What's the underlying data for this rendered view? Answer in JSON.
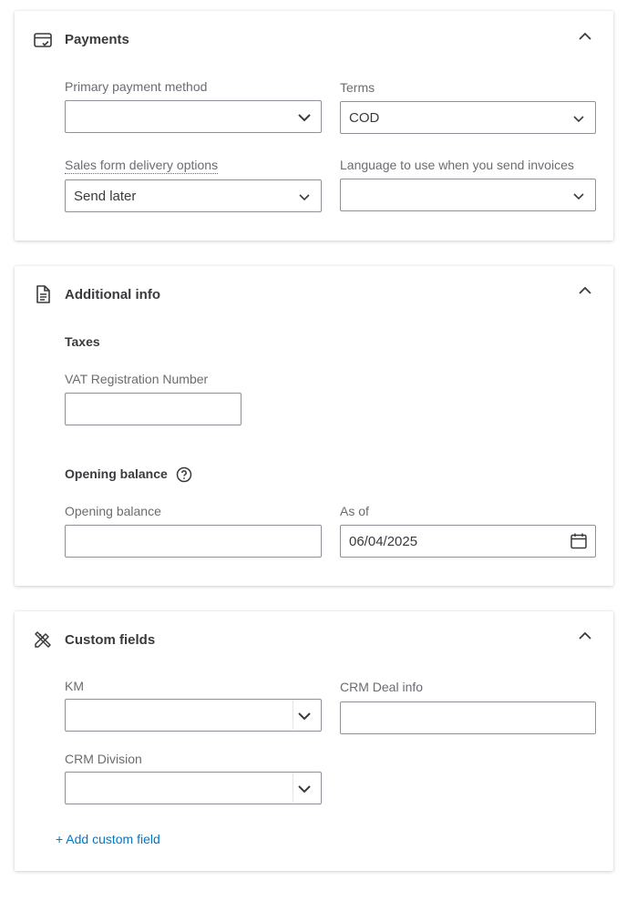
{
  "payments": {
    "title": "Payments",
    "primary_payment_method": {
      "label": "Primary payment method",
      "value": ""
    },
    "terms": {
      "label": "Terms",
      "value": "COD"
    },
    "sales_form_delivery": {
      "label": "Sales form delivery options",
      "value": "Send later"
    },
    "language": {
      "label": "Language to use when you send invoices",
      "value": ""
    }
  },
  "additional_info": {
    "title": "Additional info",
    "taxes_heading": "Taxes",
    "vat": {
      "label": "VAT Registration Number",
      "value": ""
    },
    "opening_balance_heading": "Opening balance",
    "opening_balance": {
      "label": "Opening balance",
      "value": ""
    },
    "as_of": {
      "label": "As of",
      "value": "06/04/2025"
    }
  },
  "custom_fields": {
    "title": "Custom fields",
    "km": {
      "label": "KM",
      "value": ""
    },
    "crm_deal_info": {
      "label": "CRM Deal info",
      "value": ""
    },
    "crm_division": {
      "label": "CRM Division",
      "value": ""
    },
    "add_link": "+ Add custom field"
  },
  "icons": {
    "payments": "payment-card-icon",
    "additional_info": "document-icon",
    "custom_fields": "pencil-ruler-icon",
    "collapse": "chevron-up-icon",
    "dropdown": "chevron-down-icon",
    "help": "question-circle-icon",
    "calendar": "calendar-icon"
  },
  "colors": {
    "link": "#0077c5",
    "border": "#8d9096",
    "text": "#393a3d",
    "label": "#6b6c72"
  }
}
